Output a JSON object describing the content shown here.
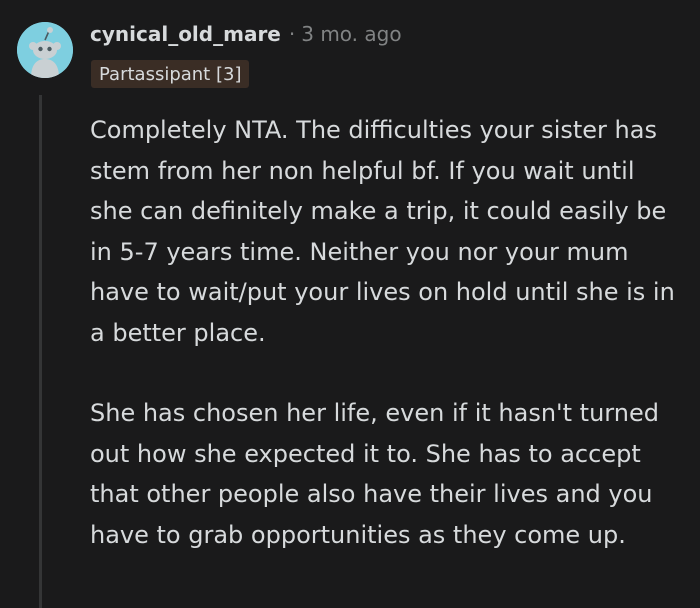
{
  "comment": {
    "author": "cynical_old_mare",
    "separator": "·",
    "time_ago": "3 mo. ago",
    "flair": "Partassipant [3]",
    "avatar_icon": "reddit-snoo-icon",
    "paragraphs": [
      "Completely NTA. The difficulties your sister has stem from her non helpful bf. If you wait until she can definitely make a trip, it could easily be in 5-7 years time. Neither you nor your mum have to wait/put your lives on hold until she is in a better place.",
      "She has chosen her life, even if it hasn't turned out how she expected it to. She has to accept that other people also have their lives and you have to grab opportunities as they come up."
    ]
  },
  "colors": {
    "background": "#1a1a1b",
    "text": "#d7dadc",
    "muted": "#818384",
    "flair_bg": "#3a2d25",
    "avatar_bg": "#7ecfe0",
    "thread_line": "#343536"
  }
}
